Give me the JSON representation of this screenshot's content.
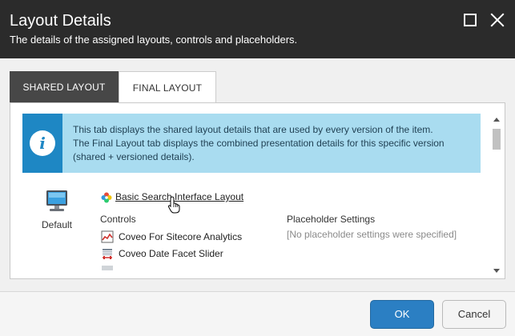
{
  "dialog": {
    "title": "Layout Details",
    "subtitle": "The details of the assigned layouts, controls and placeholders."
  },
  "tabs": [
    {
      "label": "SHARED LAYOUT",
      "active": true
    },
    {
      "label": "FINAL LAYOUT",
      "active": false
    }
  ],
  "info": {
    "line1": "This tab displays the shared layout details that are used by every version of the item.",
    "line2": "The Final Layout tab displays the combined presentation details for this specific version",
    "line3": "(shared + versioned details)."
  },
  "device": {
    "label": "Default",
    "icon": "monitor-icon"
  },
  "layout": {
    "name": "Basic Search Interface Layout",
    "icon": "layout-pinwheel-icon"
  },
  "controls": {
    "heading": "Controls",
    "items": [
      {
        "label": "Coveo For Sitecore Analytics",
        "icon": "analytics-chart-icon"
      },
      {
        "label": "Coveo Date Facet Slider",
        "icon": "slider-icon"
      }
    ]
  },
  "placeholder": {
    "heading": "Placeholder Settings",
    "empty_text": "[No placeholder settings were specified]"
  },
  "footer": {
    "ok_label": "OK",
    "cancel_label": "Cancel"
  },
  "colors": {
    "titlebar": "#2b2b2b",
    "active_tab": "#474747",
    "info_bg": "#a9dcf0",
    "info_icon_bg": "#1e87c4",
    "primary_button": "#2b7fc3"
  }
}
